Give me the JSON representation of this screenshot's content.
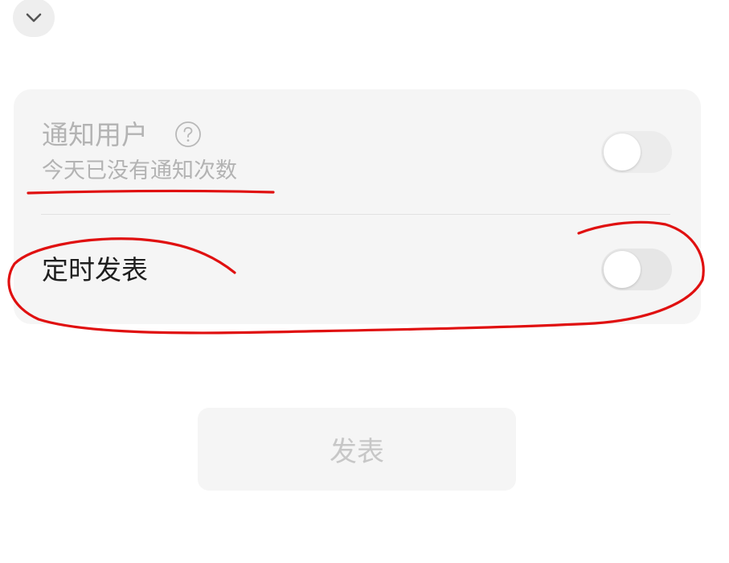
{
  "header": {
    "collapse_icon": "chevron-down-icon"
  },
  "settings": {
    "notify_users": {
      "label": "通知用户",
      "help_icon": "question-circle-icon",
      "sublabel": "今天已没有通知次数",
      "enabled": false,
      "toggle_on": false
    },
    "scheduled_publish": {
      "label": "定时发表",
      "enabled": true,
      "toggle_on": false
    }
  },
  "actions": {
    "publish_label": "发表",
    "publish_enabled": false
  },
  "annotations": {
    "color": "#e01010",
    "underline_target": "settings.notify_users.sublabel",
    "circle_target": "settings.scheduled_publish"
  }
}
